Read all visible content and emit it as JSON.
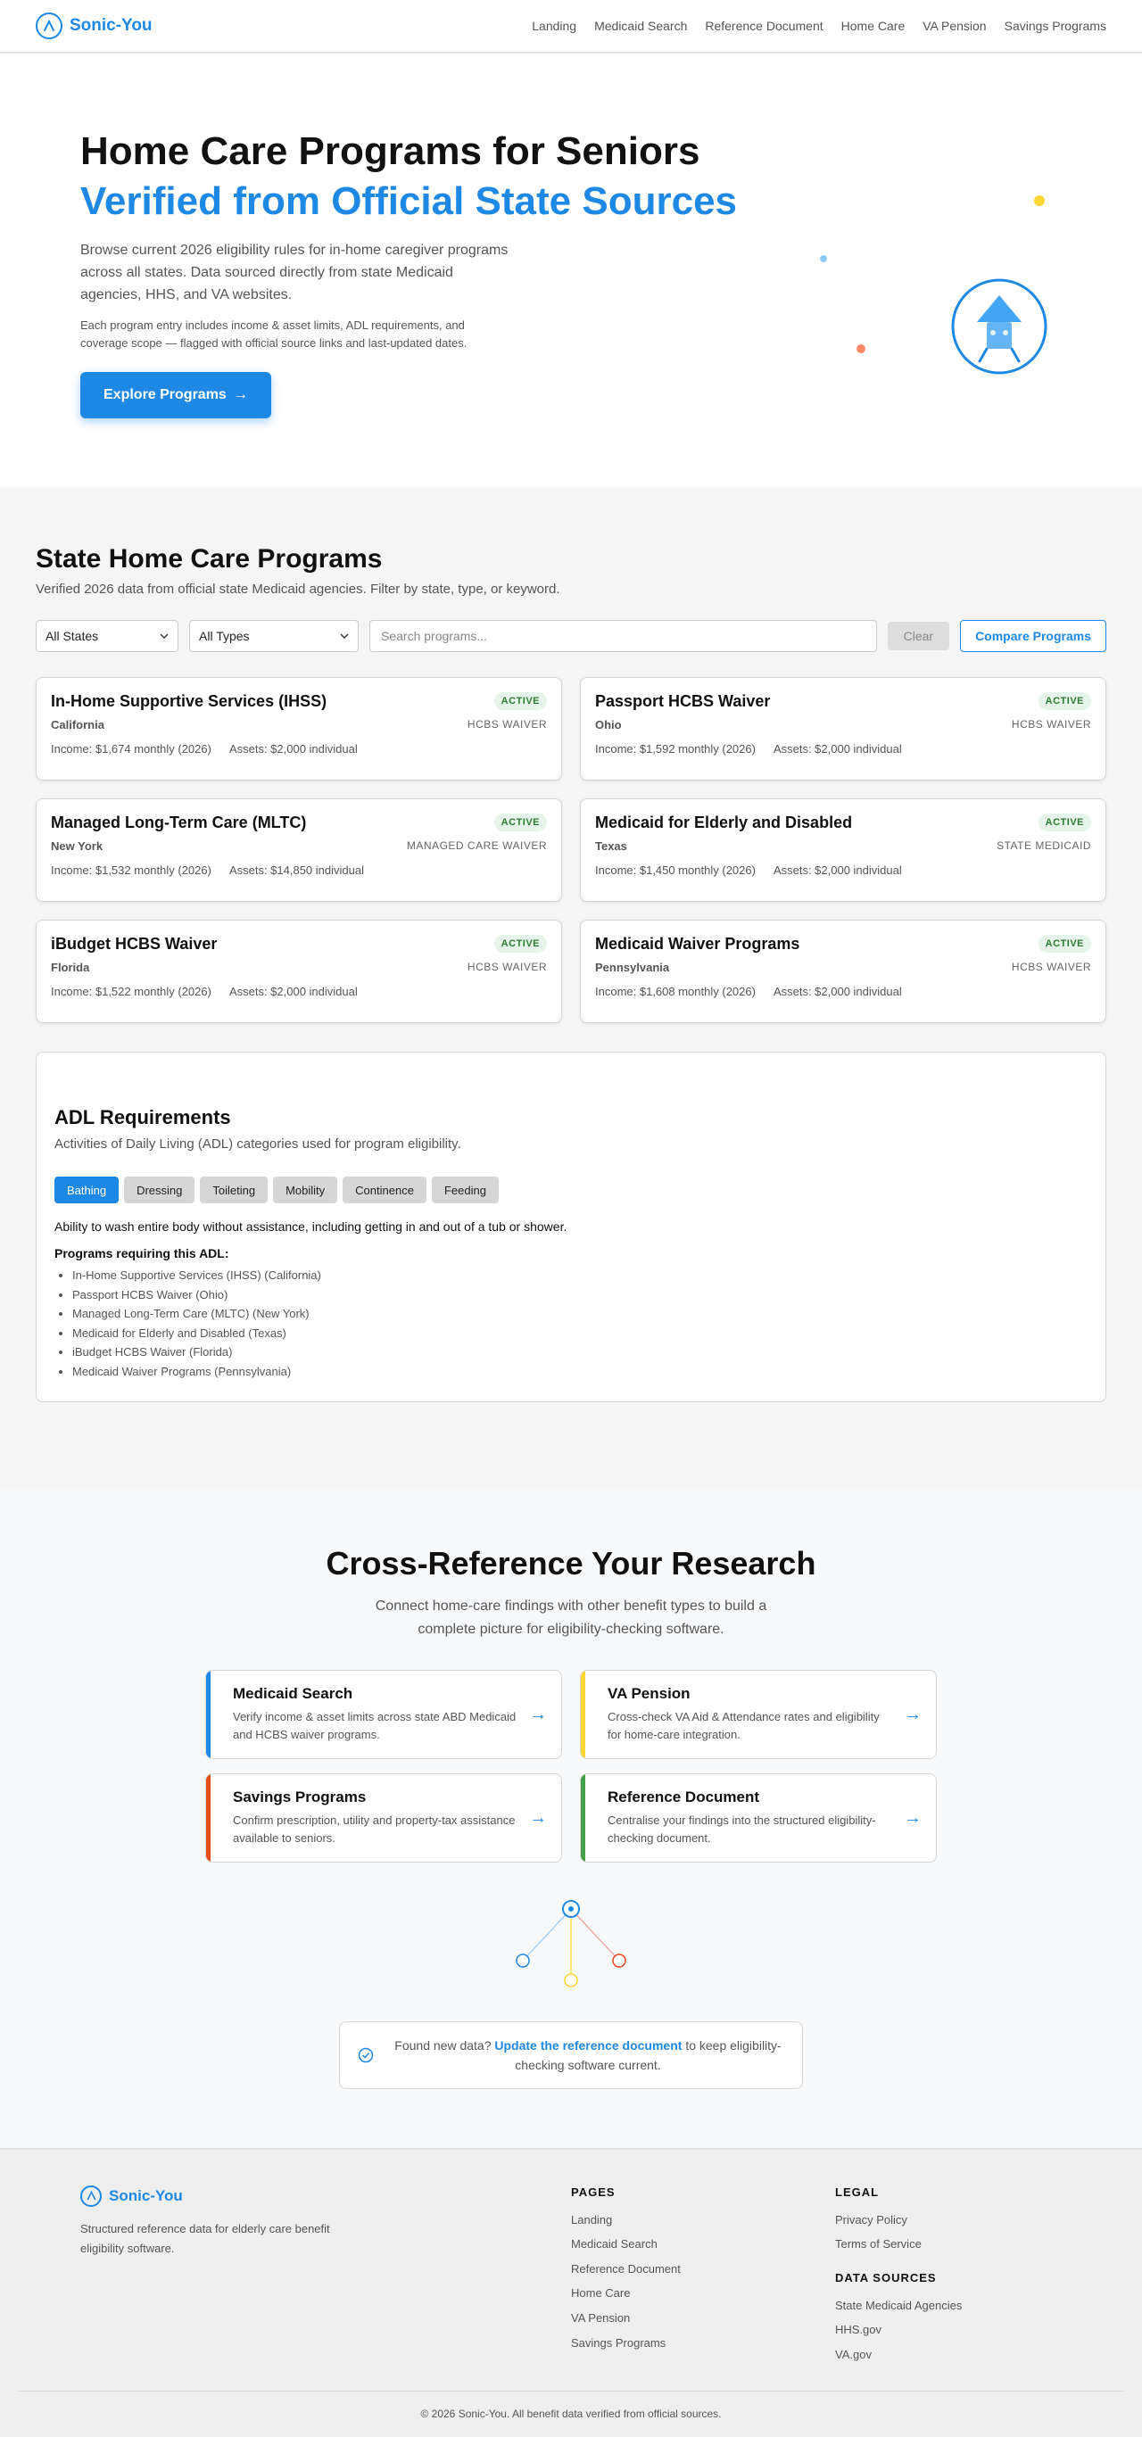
{
  "nav": {
    "brand": "Sonic-You",
    "links": [
      "Landing",
      "Medicaid Search",
      "Reference Document",
      "Home Care",
      "VA Pension",
      "Savings Programs"
    ]
  },
  "hero": {
    "title_line1": "Home Care Programs for Seniors",
    "title_line2": "Verified from Official State Sources",
    "lead": "Browse current 2026 eligibility rules for in-home caregiver programs across all states. Data sourced directly from state Medicaid agencies, HHS, and VA websites.",
    "sub": "Each program entry includes income & asset limits, ADL requirements, and coverage scope — flagged with official source links and last-updated dates.",
    "cta_label": "Explore Programs",
    "cta_arrow": "→"
  },
  "programs": {
    "title": "State Home Care Programs",
    "description": "Verified 2026 data from official state Medicaid agencies. Filter by state, type, or keyword.",
    "filters": {
      "state_select": "All States",
      "type_select": "All Types",
      "search_placeholder": "Search programs...",
      "clear_label": "Clear",
      "compare_label": "Compare Programs"
    },
    "cards": [
      {
        "title": "In-Home Supportive Services (IHSS)",
        "status": "ACTIVE",
        "state": "California",
        "type": "HCBS WAIVER",
        "income": "Income: $1,674 monthly (2026)",
        "assets": "Assets: $2,000 individual"
      },
      {
        "title": "Passport HCBS Waiver",
        "status": "ACTIVE",
        "state": "Ohio",
        "type": "HCBS WAIVER",
        "income": "Income: $1,592 monthly (2026)",
        "assets": "Assets: $2,000 individual"
      },
      {
        "title": "Managed Long-Term Care (MLTC)",
        "status": "ACTIVE",
        "state": "New York",
        "type": "MANAGED CARE WAIVER",
        "income": "Income: $1,532 monthly (2026)",
        "assets": "Assets: $14,850 individual"
      },
      {
        "title": "Medicaid for Elderly and Disabled",
        "status": "ACTIVE",
        "state": "Texas",
        "type": "STATE MEDICAID",
        "income": "Income: $1,450 monthly (2026)",
        "assets": "Assets: $2,000 individual"
      },
      {
        "title": "iBudget HCBS Waiver",
        "status": "ACTIVE",
        "state": "Florida",
        "type": "HCBS WAIVER",
        "income": "Income: $1,522 monthly (2026)",
        "assets": "Assets: $2,000 individual"
      },
      {
        "title": "Medicaid Waiver Programs",
        "status": "ACTIVE",
        "state": "Pennsylvania",
        "type": "HCBS WAIVER",
        "income": "Income: $1,608 monthly (2026)",
        "assets": "Assets: $2,000 individual"
      }
    ]
  },
  "adl": {
    "title": "ADL Requirements",
    "description": "Activities of Daily Living (ADL) categories used for program eligibility.",
    "tabs": [
      "Bathing",
      "Dressing",
      "Toileting",
      "Mobility",
      "Continence",
      "Feeding"
    ],
    "active_tab": "Bathing",
    "text": "Ability to wash entire body without assistance, including getting in and out of a tub or shower.",
    "required_heading": "Programs requiring this ADL:",
    "programs": [
      "In-Home Supportive Services (IHSS) (California)",
      "Passport HCBS Waiver (Ohio)",
      "Managed Long-Term Care (MLTC) (New York)",
      "Medicaid for Elderly and Disabled (Texas)",
      "iBudget HCBS Waiver (Florida)",
      "Medicaid Waiver Programs (Pennsylvania)"
    ]
  },
  "cross": {
    "title": "Cross-Reference Your Research",
    "lead": "Connect home-care findings with other benefit types to build a complete picture for eligibility-checking software.",
    "cards": [
      {
        "title": "Medicaid Search",
        "desc": "Verify income & asset limits across state ABD Medicaid and HCBS waiver programs.",
        "color": "#1e88e5"
      },
      {
        "title": "VA Pension",
        "desc": "Cross-check VA Aid & Attendance rates and eligibility for home-care integration.",
        "color": "#fdd835"
      },
      {
        "title": "Savings Programs",
        "desc": "Confirm prescription, utility and property-tax assistance available to seniors.",
        "color": "#e64a19"
      },
      {
        "title": "Reference Document",
        "desc": "Centralise your findings into the structured eligibility-checking document.",
        "color": "#43a047"
      }
    ],
    "arrow": "→",
    "note": {
      "before": "Found new data? ",
      "link": "Update the reference document",
      "after": " to keep eligibility-checking software current."
    }
  },
  "footer": {
    "brand": "Sonic-You",
    "tagline": "Structured reference data for elderly care benefit eligibility software.",
    "pages_heading": "PAGES",
    "pages": [
      "Landing",
      "Medicaid Search",
      "Reference Document",
      "Home Care",
      "VA Pension",
      "Savings Programs"
    ],
    "legal_heading": "LEGAL",
    "legal": [
      "Privacy Policy",
      "Terms of Service"
    ],
    "sources_heading": "DATA SOURCES",
    "sources": [
      "State Medicaid Agencies",
      "HHS.gov",
      "VA.gov"
    ],
    "copyright": "© 2026 Sonic-You. All benefit data verified from official sources."
  },
  "colors": {
    "accent": "#1e88e5",
    "active_badge": "#2e7d32",
    "yellow": "#fdd835",
    "orange": "#e64a19",
    "green": "#43a047"
  },
  "icons": [
    "brand-logo-icon",
    "lighthouse-icon",
    "chevron-down-icon",
    "arrow-right-icon",
    "check-circle-icon"
  ]
}
